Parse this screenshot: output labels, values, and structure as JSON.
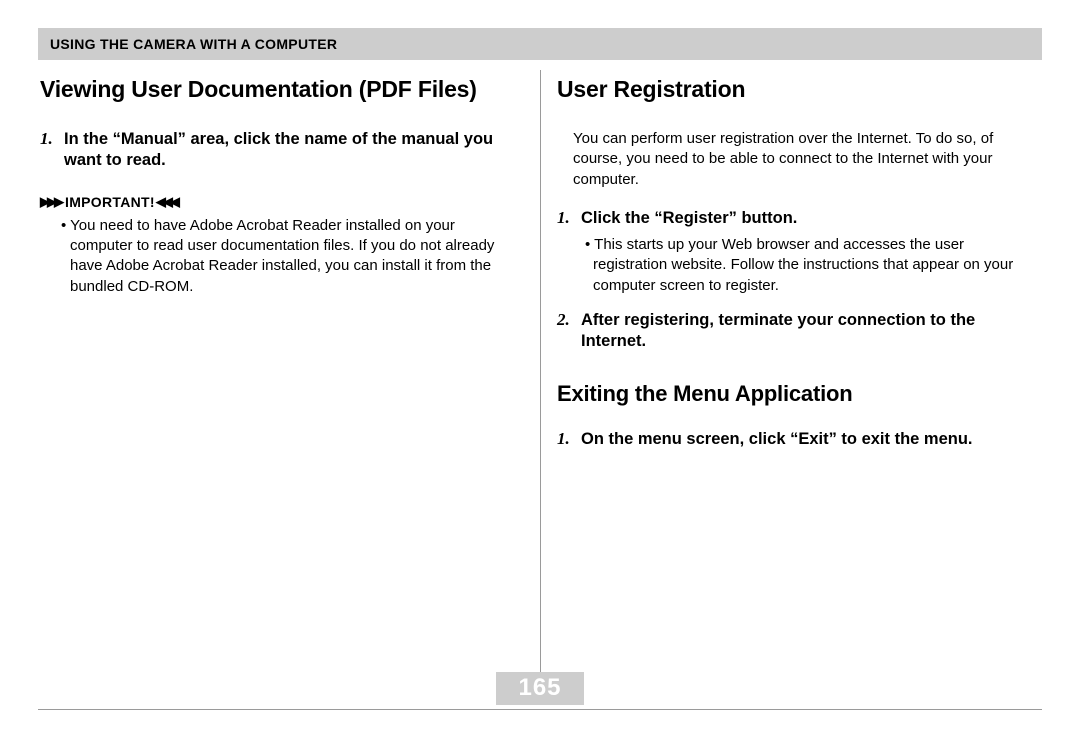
{
  "header": {
    "title": "USING THE CAMERA WITH A COMPUTER"
  },
  "left": {
    "title": "Viewing User Documentation (PDF Files)",
    "step1_num": "1.",
    "step1_text": "In the “Manual” area, click the name of the manual you want to read.",
    "important_label": "IMPORTANT!",
    "important_text": "You need to have Adobe Acrobat Reader installed on your computer to read user documentation files. If you do not already have Adobe Acrobat Reader installed, you can install it from the bundled CD-ROM."
  },
  "right": {
    "title1": "User Registration",
    "intro": "You can perform user registration over the Internet. To do so, of course, you need to be able to connect to the Internet with your computer.",
    "step1_num": "1.",
    "step1_text": "Click the “Register” button.",
    "step1_sub": "This starts up your Web browser and accesses the user registration website. Follow the instructions that appear on your computer screen to register.",
    "step2_num": "2.",
    "step2_text": "After registering, terminate your connection to the Internet.",
    "title2": "Exiting the Menu Application",
    "exit_step_num": "1.",
    "exit_step_text": "On the menu screen, click “Exit” to exit the menu."
  },
  "page_number": "165"
}
